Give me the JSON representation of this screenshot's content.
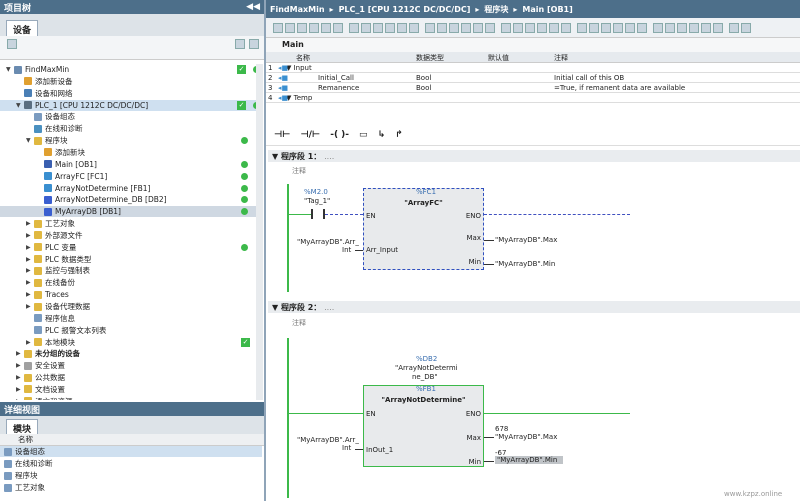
{
  "left_panel": {
    "title": "项目树",
    "tab": "设备"
  },
  "tree": [
    {
      "label": "FindMaxMin",
      "indent": 0,
      "tri": "▼",
      "icon": "project-icon",
      "color": "#6a8bb0",
      "status": "check2"
    },
    {
      "label": "添加新设备",
      "indent": 1,
      "tri": "",
      "icon": "add-device-icon",
      "color": "#e0a030",
      "status": ""
    },
    {
      "label": "设备和网络",
      "indent": 1,
      "tri": "",
      "icon": "network-icon",
      "color": "#4a7fb5",
      "status": ""
    },
    {
      "label": "PLC_1 [CPU 1212C DC/DC/DC]",
      "indent": 1,
      "tri": "▼",
      "icon": "plc-icon",
      "color": "#5a6e80",
      "status": "check2",
      "sel": true
    },
    {
      "label": "设备组态",
      "indent": 2,
      "tri": "",
      "icon": "device-config-icon",
      "color": "#7a9bc0",
      "status": ""
    },
    {
      "label": "在线和诊断",
      "indent": 2,
      "tri": "",
      "icon": "diagnostics-icon",
      "color": "#4a90c0",
      "status": ""
    },
    {
      "label": "程序块",
      "indent": 2,
      "tri": "▼",
      "icon": "folder-icon",
      "color": "#e0b840",
      "status": "dot"
    },
    {
      "label": "添加新块",
      "indent": 3,
      "tri": "",
      "icon": "add-block-icon",
      "color": "#e0a030",
      "status": ""
    },
    {
      "label": "Main [OB1]",
      "indent": 3,
      "tri": "",
      "icon": "ob-icon",
      "color": "#3a5fb0",
      "status": "dot"
    },
    {
      "label": "ArrayFC [FC1]",
      "indent": 3,
      "tri": "",
      "icon": "fc-icon",
      "color": "#3a8fd0",
      "status": "dot"
    },
    {
      "label": "ArrayNotDetermine [FB1]",
      "indent": 3,
      "tri": "",
      "icon": "fb-icon",
      "color": "#3a8fd0",
      "status": "dot"
    },
    {
      "label": "ArrayNotDetermine_DB [DB2]",
      "indent": 3,
      "tri": "",
      "icon": "db-icon",
      "color": "#3a5fd0",
      "status": "dot"
    },
    {
      "label": "MyArrayDB [DB1]",
      "indent": 3,
      "tri": "",
      "icon": "db-icon",
      "color": "#3a5fd0",
      "status": "dot",
      "hl": true
    },
    {
      "label": "工艺对象",
      "indent": 2,
      "tri": "▶",
      "icon": "folder-icon",
      "color": "#e0b840",
      "status": ""
    },
    {
      "label": "外部源文件",
      "indent": 2,
      "tri": "▶",
      "icon": "folder-icon",
      "color": "#e0b840",
      "status": ""
    },
    {
      "label": "PLC 变量",
      "indent": 2,
      "tri": "▶",
      "icon": "folder-icon",
      "color": "#e0b840",
      "status": "dot"
    },
    {
      "label": "PLC 数据类型",
      "indent": 2,
      "tri": "▶",
      "icon": "folder-icon",
      "color": "#e0b840",
      "status": ""
    },
    {
      "label": "监控与强制表",
      "indent": 2,
      "tri": "▶",
      "icon": "folder-icon",
      "color": "#e0b840",
      "status": ""
    },
    {
      "label": "在线备份",
      "indent": 2,
      "tri": "▶",
      "icon": "folder-icon",
      "color": "#e0b840",
      "status": ""
    },
    {
      "label": "Traces",
      "indent": 2,
      "tri": "▶",
      "icon": "folder-icon",
      "color": "#e0b840",
      "status": ""
    },
    {
      "label": "设备代理数据",
      "indent": 2,
      "tri": "▶",
      "icon": "folder-icon",
      "color": "#e0b840",
      "status": ""
    },
    {
      "label": "程序信息",
      "indent": 2,
      "tri": "",
      "icon": "info-icon",
      "color": "#7a9bc0",
      "status": ""
    },
    {
      "label": "PLC 报警文本列表",
      "indent": 2,
      "tri": "",
      "icon": "alarm-icon",
      "color": "#7a9bc0",
      "status": ""
    },
    {
      "label": "本地模块",
      "indent": 2,
      "tri": "▶",
      "icon": "folder-icon",
      "color": "#e0b840",
      "status": "check"
    },
    {
      "label": "未分组的设备",
      "indent": 1,
      "tri": "▶",
      "icon": "folder-icon",
      "color": "#e0b840",
      "status": "",
      "bold": true
    },
    {
      "label": "安全设置",
      "indent": 1,
      "tri": "▶",
      "icon": "security-icon",
      "color": "#a0a0a0",
      "status": ""
    },
    {
      "label": "公共数据",
      "indent": 1,
      "tri": "▶",
      "icon": "folder-icon",
      "color": "#e0b840",
      "status": ""
    },
    {
      "label": "文档设置",
      "indent": 1,
      "tri": "▶",
      "icon": "folder-icon",
      "color": "#e0b840",
      "status": ""
    },
    {
      "label": "语言和资源",
      "indent": 1,
      "tri": "▶",
      "icon": "folder-icon",
      "color": "#e0b840",
      "status": ""
    }
  ],
  "detail": {
    "title": "详细视图",
    "tab": "模块",
    "col": "名称",
    "items": [
      "设备组态",
      "在线和诊断",
      "程序块",
      "工艺对象"
    ]
  },
  "breadcrumb": {
    "parts": [
      "FindMaxMin",
      "PLC_1 [CPU 1212C DC/DC/DC]",
      "程序块",
      "Main [OB1]"
    ],
    "sep": "▸"
  },
  "block": {
    "name": "Main"
  },
  "iface": {
    "headers": [
      "名称",
      "数据类型",
      "默认值",
      "注释"
    ],
    "rows": [
      {
        "no": "1",
        "name": "▼ Input",
        "type": "",
        "def": "",
        "cmt": ""
      },
      {
        "no": "2",
        "name": "Initial_Call",
        "type": "Bool",
        "def": "",
        "cmt": "Initial call of this OB"
      },
      {
        "no": "3",
        "name": "Remanence",
        "type": "Bool",
        "def": "",
        "cmt": "=True, if remanent data are available"
      },
      {
        "no": "4",
        "name": "▼ Temp",
        "type": "",
        "def": "",
        "cmt": ""
      }
    ]
  },
  "networks": [
    {
      "title": "程序段 1：",
      "more": "....",
      "comment": "注释",
      "contact_addr": "%M2.0",
      "contact_name": "\"Tag_1\"",
      "fc_top": "%FC1",
      "fc_name": "\"ArrayFC\"",
      "en": "EN",
      "eno": "ENO",
      "in_pin": "Arr_Input",
      "in_arg": "\"MyArrayDB\".Arr_",
      "in_type": "Int",
      "out1_pin": "Max",
      "out1_arg": "\"MyArrayDB\".Max",
      "out2_pin": "Min",
      "out2_arg": "\"MyArrayDB\".Min"
    },
    {
      "title": "程序段 2：",
      "more": "....",
      "comment": "注释",
      "db_addr": "%DB2",
      "db_name1": "\"ArrayNotDetermi",
      "db_name2": "ne_DB\"",
      "fb_top": "%FB1",
      "fb_name": "\"ArrayNotDetermine\"",
      "en": "EN",
      "eno": "ENO",
      "in_pin": "InOut_1",
      "in_arg": "\"MyArrayDB\".Arr_",
      "in_type": "Int",
      "out1_pin": "Max",
      "out1_val": "678",
      "out1_arg": "\"MyArrayDB\".Max",
      "out2_pin": "Min",
      "out2_val": "-67",
      "out2_arg": "\"MyArrayDB\".Min"
    }
  ],
  "ladder_tools": [
    "⊣⊢",
    "⊣/⊢",
    "-( )-",
    "▭",
    "↳",
    "↱"
  ],
  "watermark": "www.kzpz.online"
}
